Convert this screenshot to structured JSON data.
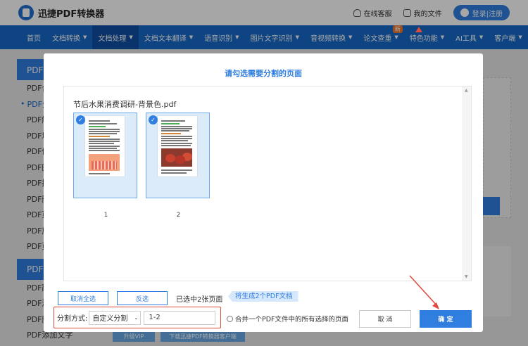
{
  "app": {
    "logo_text": "迅捷PDF转换器",
    "top_links": [
      {
        "label": "在线客服",
        "icon": "headset-icon"
      },
      {
        "label": "我的文件",
        "icon": "file-icon"
      }
    ],
    "login_label": "登录|注册"
  },
  "nav": {
    "items": [
      {
        "label": "首页"
      },
      {
        "label": "文档转换"
      },
      {
        "label": "文档处理"
      },
      {
        "label": "文档文本翻译"
      },
      {
        "label": "语音识别"
      },
      {
        "label": "图片文字识别"
      },
      {
        "label": "音视频转换"
      },
      {
        "label": "论文查重",
        "badge": "新"
      },
      {
        "label": "特色功能"
      },
      {
        "label": "AI工具"
      },
      {
        "label": "客户端"
      }
    ]
  },
  "sidebar": {
    "group1": "PDF分",
    "items": [
      "PDF合",
      "PDF分",
      "PDF解",
      "PDF增",
      "PDF修",
      "PDF图",
      "PDF摘",
      "PDF删",
      "PDF页",
      "PDF旋",
      "PDF页"
    ],
    "group2": "PDF编",
    "items2": [
      "PDF翻",
      "PDF添",
      "PDF删",
      "PDF添加文字"
    ]
  },
  "background": {
    "btn_a": "升级VIP",
    "btn_b": "下载迅捷PDF转换器客户端"
  },
  "dialog": {
    "title": "请勾选需要分割的页面",
    "file_name": "节后水果消费调研-背景色.pdf",
    "pages": [
      {
        "number": "1",
        "checked": true
      },
      {
        "number": "2",
        "checked": true
      }
    ],
    "deselect_all": "取消全选",
    "invert_select": "反选",
    "selected_status": "已选中2张页面",
    "generate_tag": "将生成2个PDF文档",
    "split_label": "分割方式:",
    "split_mode": "自定义分割",
    "split_range": "1-2",
    "merge_option": "合并一个PDF文件中的所有选择的页面",
    "cancel": "取 消",
    "confirm": "确 定"
  },
  "colors": {
    "primary": "#2f7ee0",
    "nav_bg": "#1769c9",
    "highlight_red": "#e04a3a"
  }
}
